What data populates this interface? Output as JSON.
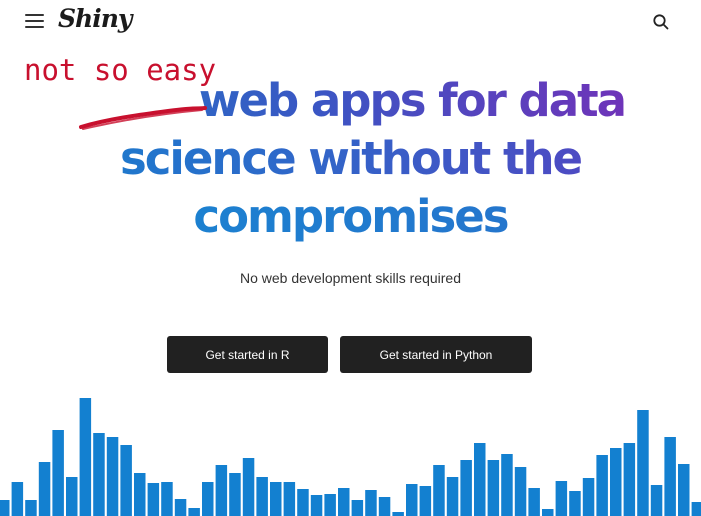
{
  "nav": {
    "menu_icon": "hamburger-menu-icon",
    "logo_text": "Shiny",
    "search_icon": "search-icon"
  },
  "annotation": {
    "text": "not so easy",
    "color": "#c8102e"
  },
  "hero": {
    "line1_struck": "Easy",
    "line1_rest": " web apps for data",
    "line2": "science without the",
    "line3": "compromises"
  },
  "subtitle": "No web development skills required",
  "buttons": {
    "get_started_r": "Get started in R",
    "get_started_python": "Get started in Python"
  },
  "colors": {
    "bar": "#1380d0",
    "button_bg": "#212121",
    "gradient_start": "#1787d2",
    "gradient_end": "#7b2bb6"
  },
  "decoration_bars": {
    "values": [
      16,
      34,
      16,
      54,
      86,
      39,
      118,
      83,
      79,
      71,
      43,
      33,
      34,
      17,
      8,
      34,
      51,
      43,
      58,
      39,
      34,
      34,
      27,
      21,
      22,
      28,
      16,
      26,
      19,
      4,
      32,
      30,
      51,
      39,
      56,
      73,
      56,
      62,
      49,
      28,
      7,
      35,
      25,
      38,
      61,
      68,
      73,
      106,
      31,
      79,
      52,
      14,
      21,
      30
    ]
  }
}
